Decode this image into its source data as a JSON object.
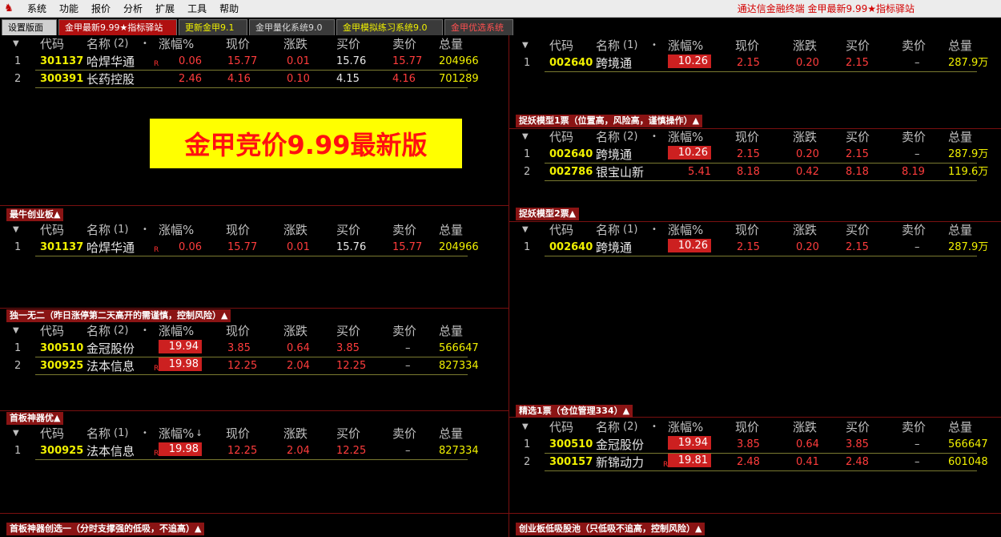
{
  "menubar": {
    "items": [
      "系统",
      "功能",
      "报价",
      "分析",
      "扩展",
      "工具",
      "帮助"
    ],
    "info": "通达信金融终端  金甲最新9.99★指标驿站"
  },
  "tabs": [
    {
      "label": "设置版面",
      "bg": "#d0d0d0",
      "color": "#000000"
    },
    {
      "label": "金甲最新9.99★指标驿站",
      "bg": "#b01010",
      "color": "#ffffff"
    },
    {
      "label": "更新金甲9.1",
      "bg": "#3a3a3a",
      "color": "#f0f000"
    },
    {
      "label": "金甲量化系统9.0",
      "bg": "#3a3a3a",
      "color": "#d8d8d8"
    },
    {
      "label": "金甲模拟练习系统9.0",
      "bg": "#3a3a3a",
      "color": "#f0f000"
    },
    {
      "label": "金甲优选系统",
      "bg": "#3a3a3a",
      "color": "#ff5050"
    }
  ],
  "banner": {
    "text": "金甲竞价9.99最新版"
  },
  "columns": [
    "代码",
    "名称",
    "涨幅%",
    "现价",
    "涨跌",
    "买价",
    "卖价",
    "总量"
  ],
  "panels": [
    {
      "id": "p1",
      "title": "",
      "name_count": "(2)",
      "rows": [
        {
          "idx": "1",
          "code": "301137",
          "name": "哈焊华通",
          "r": "R",
          "pct": "0.06",
          "price": "15.77",
          "chg": "0.01",
          "buy": "15.76",
          "sell": "15.77",
          "vol": "204966"
        },
        {
          "idx": "2",
          "code": "300391",
          "name": "长药控股",
          "r": "",
          "pct": "2.46",
          "price": "4.16",
          "chg": "0.10",
          "buy": "4.15",
          "sell": "4.16",
          "vol": "701289"
        }
      ]
    },
    {
      "id": "p2",
      "title": "最牛创业板▲",
      "name_count": "(1)",
      "rows": [
        {
          "idx": "1",
          "code": "301137",
          "name": "哈焊华通",
          "r": "R",
          "pct": "0.06",
          "price": "15.77",
          "chg": "0.01",
          "buy": "15.76",
          "sell": "15.77",
          "vol": "204966"
        }
      ]
    },
    {
      "id": "p3",
      "title": "独一无二（昨日涨停第二天高开的需谨慎，控制风险）▲",
      "name_count": "(2)",
      "rows": [
        {
          "idx": "1",
          "code": "300510",
          "name": "金冠股份",
          "r": "",
          "pct": "19.94",
          "price": "3.85",
          "chg": "0.64",
          "buy": "3.85",
          "sell": "–",
          "vol": "566647"
        },
        {
          "idx": "2",
          "code": "300925",
          "name": "法本信息",
          "r": "R",
          "pct": "19.98",
          "price": "12.25",
          "chg": "2.04",
          "buy": "12.25",
          "sell": "–",
          "vol": "827334"
        }
      ]
    },
    {
      "id": "p4",
      "title": "首板神器优▲",
      "name_count": "(1)",
      "rows": [
        {
          "idx": "1",
          "code": "300925",
          "name": "法本信息",
          "r": "R",
          "pct": "19.98",
          "price": "12.25",
          "chg": "2.04",
          "buy": "12.25",
          "sell": "–",
          "vol": "827334"
        }
      ]
    },
    {
      "id": "p5",
      "title": "首板神器创选一（分时支撑强的低吸，不追高）▲",
      "name_count": "",
      "rows": []
    },
    {
      "id": "p6",
      "title": "",
      "name_count": "(1)",
      "rows": [
        {
          "idx": "1",
          "code": "002640",
          "name": "跨境通",
          "r": "",
          "pct": "10.26",
          "price": "2.15",
          "chg": "0.20",
          "buy": "2.15",
          "sell": "–",
          "vol": "287.9万"
        }
      ]
    },
    {
      "id": "p7",
      "title": "捉妖模型1票（位置高，风险高，谨慎操作）▲",
      "name_count": "(2)",
      "rows": [
        {
          "idx": "1",
          "code": "002640",
          "name": "跨境通",
          "r": "",
          "pct": "10.26",
          "price": "2.15",
          "chg": "0.20",
          "buy": "2.15",
          "sell": "–",
          "vol": "287.9万"
        },
        {
          "idx": "2",
          "code": "002786",
          "name": "银宝山新",
          "r": "",
          "pct": "5.41",
          "price": "8.18",
          "chg": "0.42",
          "buy": "8.18",
          "sell": "8.19",
          "vol": "119.6万"
        }
      ]
    },
    {
      "id": "p8",
      "title": "捉妖模型2票▲",
      "name_count": "(1)",
      "rows": [
        {
          "idx": "1",
          "code": "002640",
          "name": "跨境通",
          "r": "",
          "pct": "10.26",
          "price": "2.15",
          "chg": "0.20",
          "buy": "2.15",
          "sell": "–",
          "vol": "287.9万"
        }
      ]
    },
    {
      "id": "p9",
      "title": "精选1票（仓位管理334）▲",
      "name_count": "(2)",
      "rows": [
        {
          "idx": "1",
          "code": "300510",
          "name": "金冠股份",
          "r": "",
          "pct": "19.94",
          "price": "3.85",
          "chg": "0.64",
          "buy": "3.85",
          "sell": "–",
          "vol": "566647"
        },
        {
          "idx": "2",
          "code": "300157",
          "name": "新锦动力",
          "r": "R",
          "pct": "19.81",
          "price": "2.48",
          "chg": "0.41",
          "buy": "2.48",
          "sell": "–",
          "vol": "601048"
        }
      ]
    },
    {
      "id": "p10",
      "title": "创业板低吸股池（只低吸不追高，控制风险）▲",
      "name_count": "",
      "rows": []
    }
  ]
}
